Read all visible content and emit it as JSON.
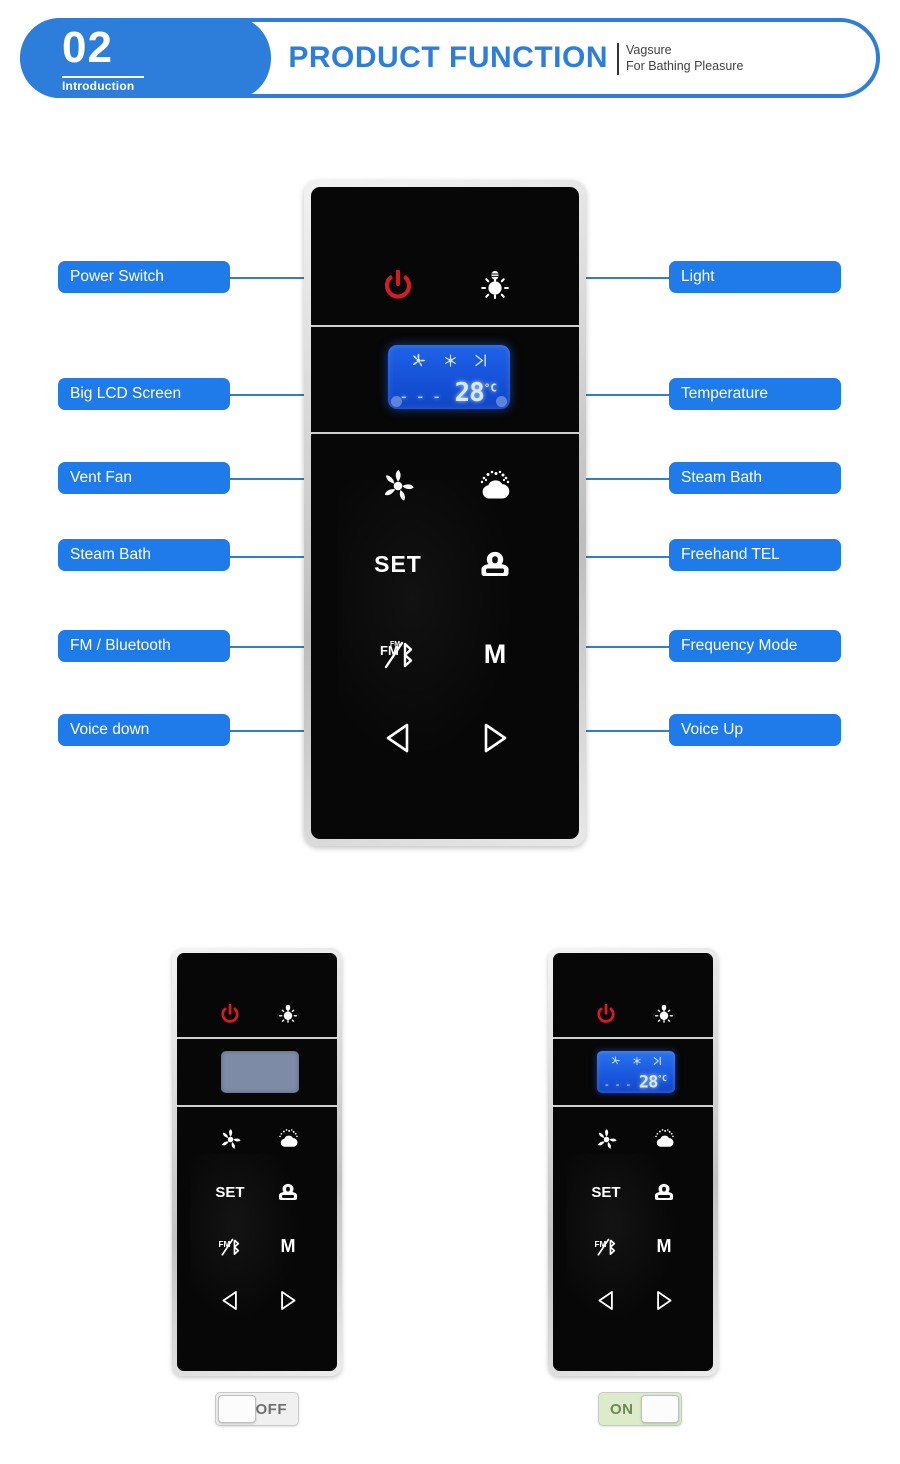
{
  "header": {
    "number": "02",
    "number_sub": "Introduction",
    "title": "PRODUCT FUNCTION",
    "brand": "Vagsure",
    "slogan": "For Bathing Pleasure",
    "accent_color": "#2d7ddb"
  },
  "colors": {
    "label_blue": "#1f7aea",
    "line_blue": "#2d7ddb",
    "power_red": "#d31d22",
    "lcd_blue": "#1552d8",
    "toggle_on_green": "#dceccb",
    "toggle_off_gray": "#f0f0f0"
  },
  "remote": {
    "lcd": {
      "icons": [
        "fan-icon",
        "snowflake-sun-icon",
        "airflow-icon"
      ],
      "dashes": "- - -",
      "temperature": "28",
      "unit": "°C"
    },
    "buttons": [
      {
        "id": "power",
        "icon": "power-icon",
        "glyph": "⏻",
        "column": "left",
        "row": 1
      },
      {
        "id": "light",
        "icon": "light-bulb-icon",
        "glyph": "",
        "column": "right",
        "row": 1
      },
      {
        "id": "vent-fan",
        "icon": "fan-blade-icon",
        "glyph": "",
        "column": "left",
        "row": 2
      },
      {
        "id": "steam",
        "icon": "steam-cloud-icon",
        "glyph": "",
        "column": "right",
        "row": 2
      },
      {
        "id": "set",
        "icon": "set-text-icon",
        "glyph": "SET",
        "column": "left",
        "row": 3
      },
      {
        "id": "tel",
        "icon": "telephone-icon",
        "glyph": "☎",
        "column": "right",
        "row": 3
      },
      {
        "id": "fm-bt",
        "icon": "fm-bluetooth-icon",
        "glyph": "",
        "column": "left",
        "row": 4
      },
      {
        "id": "mode",
        "icon": "mode-text-icon",
        "glyph": "M",
        "column": "right",
        "row": 4
      },
      {
        "id": "voice-dn",
        "icon": "triangle-left-icon",
        "glyph": "◁",
        "column": "left",
        "row": 5
      },
      {
        "id": "voice-up",
        "icon": "triangle-right-icon",
        "glyph": "▷",
        "column": "right",
        "row": 5
      }
    ]
  },
  "callouts": {
    "left": [
      {
        "label": "Power Switch",
        "target": "power"
      },
      {
        "label": "Big LCD Screen",
        "target": "lcd"
      },
      {
        "label": "Vent Fan",
        "target": "vent-fan"
      },
      {
        "label": "Steam Bath",
        "target": "set"
      },
      {
        "label": "FM / Bluetooth",
        "target": "fm-bt"
      },
      {
        "label": "Voice down",
        "target": "voice-dn"
      }
    ],
    "right": [
      {
        "label": "Light",
        "target": "light"
      },
      {
        "label": "Temperature",
        "target": "lcd"
      },
      {
        "label": "Steam Bath",
        "target": "steam"
      },
      {
        "label": "Freehand TEL",
        "target": "tel"
      },
      {
        "label": "Frequency Mode",
        "target": "mode"
      },
      {
        "label": "Voice Up",
        "target": "voice-up"
      }
    ]
  },
  "states": [
    {
      "id": "off",
      "toggle_label": "OFF",
      "lcd_active": false
    },
    {
      "id": "on",
      "toggle_label": "ON",
      "lcd_active": true
    }
  ]
}
